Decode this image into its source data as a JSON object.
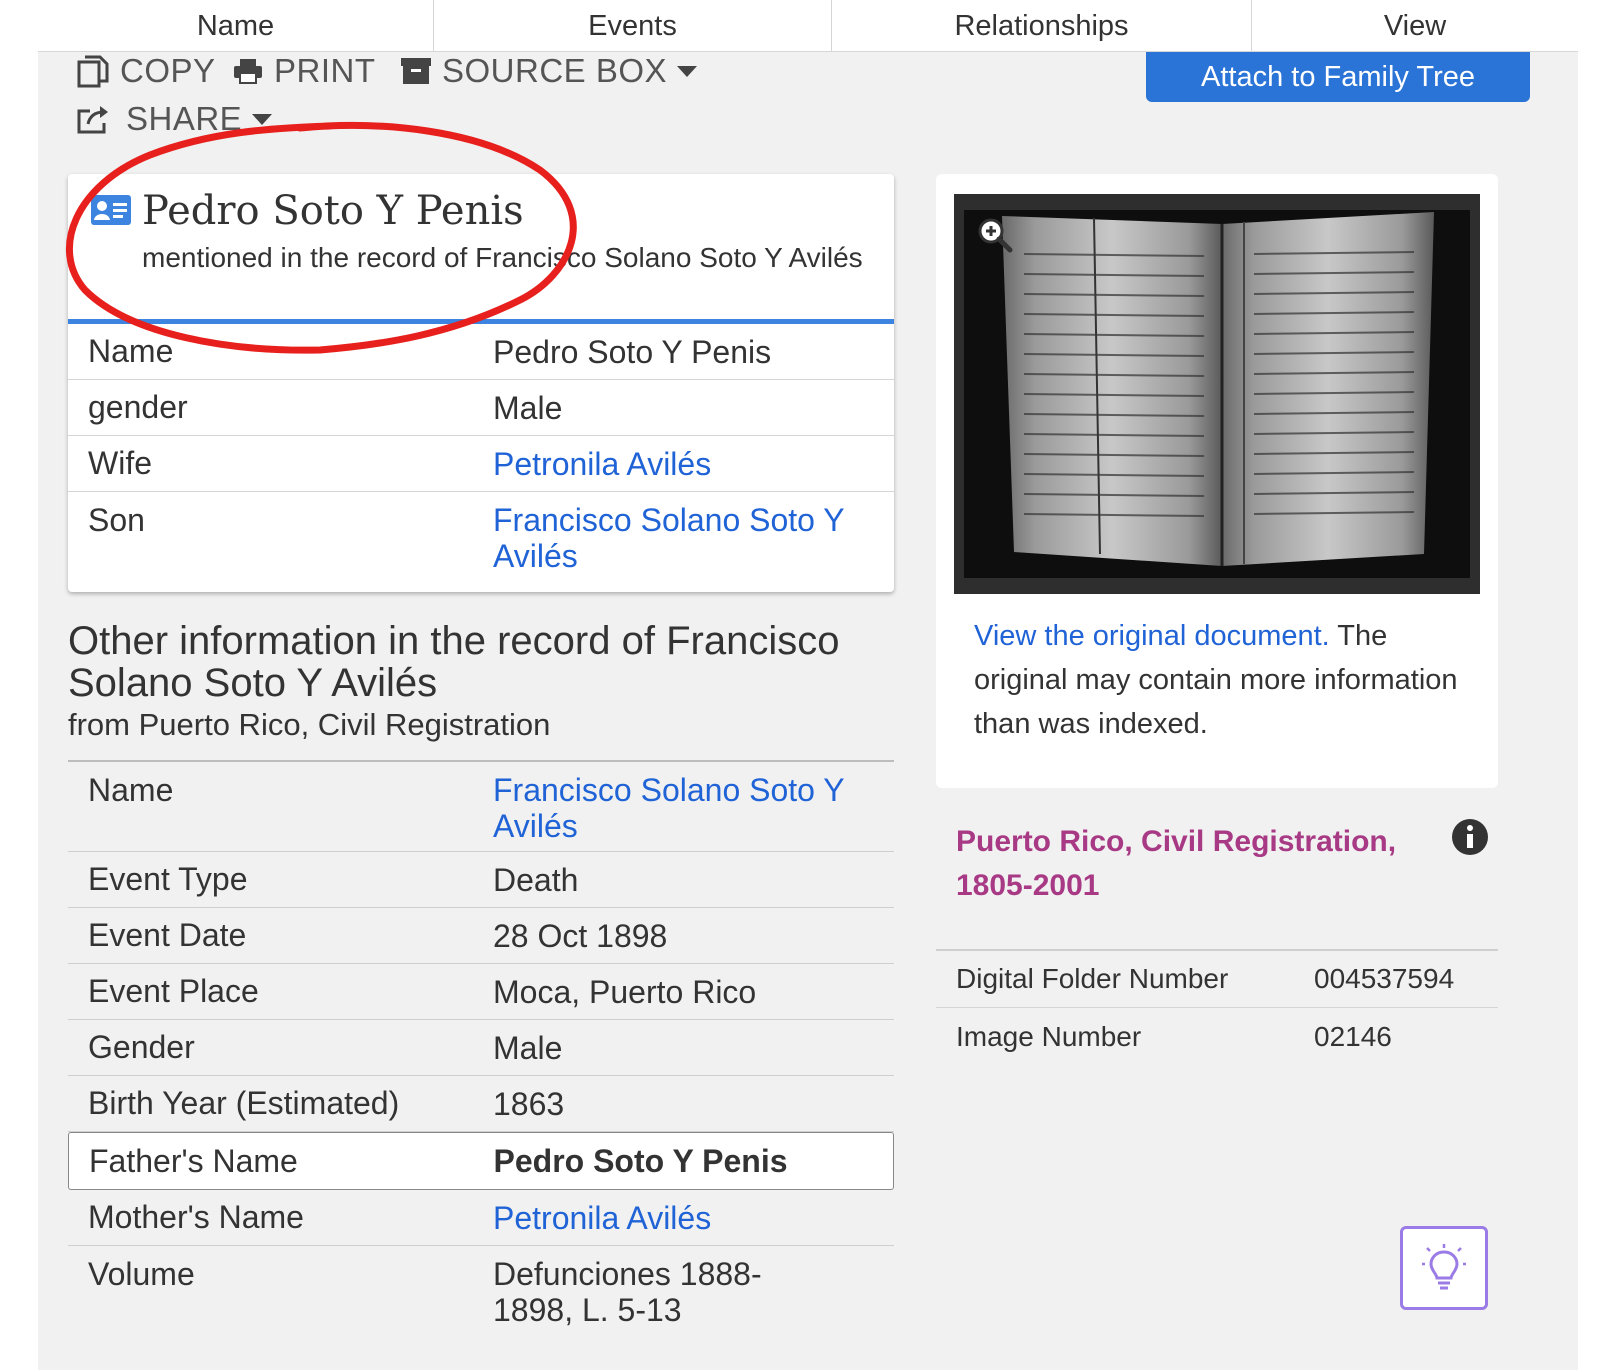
{
  "nav": {
    "tabs": [
      "Name",
      "Events",
      "Relationships",
      "View"
    ]
  },
  "toolbar": {
    "copy": "COPY",
    "print": "PRINT",
    "source_box": "SOURCE BOX",
    "share": "SHARE",
    "attach": "Attach to Family Tree"
  },
  "person": {
    "name": "Pedro Soto Y Penis",
    "subtitle": "mentioned in the record of Francisco Solano Soto Y Avilés",
    "rows": [
      {
        "label": "Name",
        "value": "Pedro Soto Y Penis",
        "link": false
      },
      {
        "label": "gender",
        "value": "Male",
        "link": false
      },
      {
        "label": "Wife",
        "value": "Petronila Avilés",
        "link": true
      },
      {
        "label": "Son",
        "value": "Francisco Solano Soto Y Avilés",
        "link": true
      }
    ]
  },
  "other": {
    "title": "Other information in the record of Francisco Solano Soto Y Avilés",
    "subtitle": "from Puerto Rico, Civil Registration",
    "rows": [
      {
        "label": "Name",
        "value": "Francisco Solano Soto Y Avilés",
        "link": true
      },
      {
        "label": "Event Type",
        "value": "Death",
        "link": false
      },
      {
        "label": "Event Date",
        "value": "28 Oct 1898",
        "link": false
      },
      {
        "label": "Event Place",
        "value": "Moca, Puerto Rico",
        "link": false
      },
      {
        "label": "Gender",
        "value": "Male",
        "link": false
      },
      {
        "label": "Birth Year (Estimated)",
        "value": "1863",
        "link": false
      },
      {
        "label": "Father's Name",
        "value": "Pedro Soto Y Penis",
        "link": false,
        "highlight": true
      },
      {
        "label": "Mother's Name",
        "value": "Petronila Avilés",
        "link": true
      },
      {
        "label": "Volume",
        "value": "Defunciones 1888-1898, L. 5-13",
        "link": false
      }
    ]
  },
  "image_panel": {
    "link_text": "View the original document.",
    "text": " The original may contain more information than was indexed."
  },
  "collection": {
    "title": "Puerto Rico, Civil Registration, 1805-2001",
    "rows": [
      {
        "label": "Digital Folder Number",
        "value": "004537594"
      },
      {
        "label": "Image Number",
        "value": "02146"
      }
    ]
  },
  "colors": {
    "link": "#1f63d6",
    "accent_blue": "#2a73d7",
    "collection_title": "#a83a85",
    "annotation_red": "#e8201d"
  }
}
